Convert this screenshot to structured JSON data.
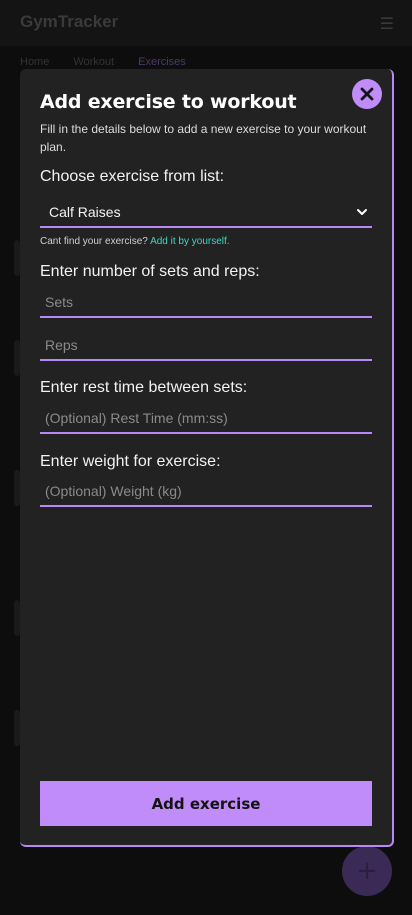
{
  "background": {
    "app_title": "GymTracker",
    "menu_icon": "menu-icon",
    "tabs": [
      {
        "label": "Home"
      },
      {
        "label": "Workout"
      },
      {
        "label": "Exercises"
      }
    ],
    "fab_icon": "plus-icon"
  },
  "modal": {
    "title": "Add exercise to workout",
    "subtitle": "Fill in the details below to add a new exercise to your workout plan.",
    "close_icon": "close-icon",
    "choose_label": "Choose exercise from list:",
    "selected_exercise": "Calf Raises",
    "hint_prefix": "Cant find your exercise?",
    "hint_link": "Add it by yourself.",
    "sets_reps_label": "Enter number of sets and reps:",
    "sets_placeholder": "Sets",
    "reps_placeholder": "Reps",
    "rest_label": "Enter rest time between sets:",
    "rest_placeholder": "(Optional) Rest Time (mm:ss)",
    "weight_label": "Enter weight for exercise:",
    "weight_placeholder": "(Optional) Weight (kg)",
    "submit_label": "Add exercise"
  },
  "colors": {
    "accent": "#c08cfa",
    "link": "#3ed6c3",
    "modal_bg": "#222222"
  }
}
